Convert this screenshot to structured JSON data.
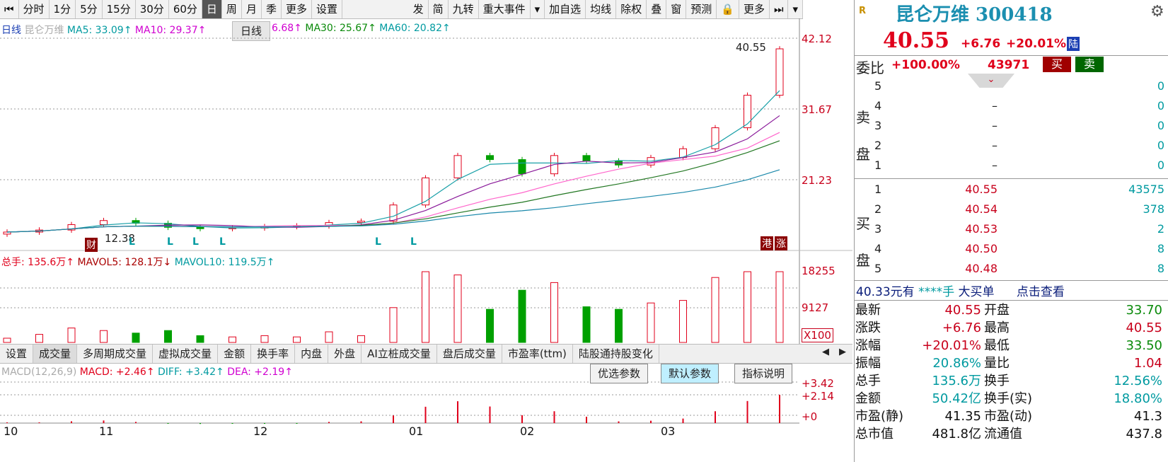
{
  "toolbar": {
    "left": [
      "分时",
      "1分",
      "5分",
      "15分",
      "30分",
      "60分",
      "日",
      "周",
      "月",
      "季",
      "更多",
      "设置"
    ],
    "right": [
      "发",
      "简",
      "九转",
      "重大事件",
      "▾",
      "加自选",
      "均线",
      "除权",
      "叠",
      "窗",
      "预测",
      "🔒",
      "更多",
      "⏭",
      "▾"
    ],
    "active": "日"
  },
  "tooltip": "日线",
  "ma_legend": {
    "label": "日线",
    "name": "昆仑万维",
    "ma5": "MA5: 33.09↑",
    "ma10": "MA10: 29.37↑",
    "ma20": "6.68↑",
    "ma30": "MA30: 25.67↑",
    "ma60": "MA60: 20.82↑"
  },
  "price_axis": [
    "42.12",
    "31.67",
    "21.23"
  ],
  "price_annotations": {
    "high": "40.55",
    "low": "12.38",
    "cai": "财",
    "gang": "港",
    "zhang": "涨",
    "l_marks": [
      "L",
      "L",
      "L",
      "L",
      "L",
      "L"
    ]
  },
  "volume_legend": {
    "total": "总手: 135.6万↑",
    "mavol5": "MAVOL5: 128.1万↓",
    "mavol10": "MAVOL10: 119.5万↑"
  },
  "volume_axis": [
    "18255",
    "9127",
    "X100"
  ],
  "tabs": [
    "设置",
    "成交量",
    "多周期成交量",
    "虚拟成交量",
    "金额",
    "换手率",
    "内盘",
    "外盘",
    "AI立桩成交量",
    "盘后成交量",
    "市盈率(ttm)",
    "陆股通持股变化"
  ],
  "tabs_active": "成交量",
  "macd_legend": {
    "name": "MACD(12,26,9)",
    "macd": "MACD: +2.46↑",
    "diff": "DIFF: +3.42↑",
    "dea": "DEA: +2.19↑"
  },
  "macd_buttons": [
    "优选参数",
    "默认参数",
    "指标说明"
  ],
  "macd_axis": [
    "+3.42",
    "+2.14",
    "+0"
  ],
  "x_axis": [
    "10",
    "11",
    "12",
    "01",
    "02",
    "03"
  ],
  "colors": {
    "up": "#e0001b",
    "down": "#00a000",
    "ma5": "#1aa0a8",
    "ma10": "#8a1a9a",
    "ma20": "#ff66cc",
    "ma30": "#227722",
    "ma60": "#1a88aa"
  },
  "chart_data": {
    "type": "candlestick",
    "title": "",
    "x": [
      "10",
      "11",
      "12",
      "01",
      "02",
      "03"
    ],
    "close_approx": [
      13.5,
      13.8,
      14.6,
      15.2,
      14.8,
      14.2,
      14.0,
      14.1,
      14.3,
      14.4,
      14.9,
      15.1,
      17.5,
      21.5,
      24.8,
      24.2,
      22.1,
      24.8,
      24.0,
      23.4,
      24.5,
      25.8,
      28.9,
      33.7,
      40.55
    ],
    "ylim": [
      12.0,
      43.0
    ]
  },
  "quote": {
    "r": "R",
    "name": "昆仑万维 300418",
    "price": "40.55",
    "change": "+6.76",
    "pct": "+20.01%",
    "lu": "陆",
    "wb_label": "委比",
    "wb_value": "+100.00%",
    "wb_diff": "43971",
    "buy_btn": "买",
    "sell_btn": "卖",
    "sell_label": [
      "卖",
      "盘"
    ],
    "buy_label": [
      "买",
      "盘"
    ],
    "sells": [
      {
        "lv": "5",
        "price": "",
        "vol": "0"
      },
      {
        "lv": "4",
        "price": "–",
        "vol": "0"
      },
      {
        "lv": "3",
        "price": "–",
        "vol": "0"
      },
      {
        "lv": "2",
        "price": "–",
        "vol": "0"
      },
      {
        "lv": "1",
        "price": "–",
        "vol": "0"
      }
    ],
    "buys": [
      {
        "lv": "1",
        "price": "40.55",
        "vol": "43575"
      },
      {
        "lv": "2",
        "price": "40.54",
        "vol": "378"
      },
      {
        "lv": "3",
        "price": "40.53",
        "vol": "2"
      },
      {
        "lv": "4",
        "price": "40.50",
        "vol": "8"
      },
      {
        "lv": "5",
        "price": "40.48",
        "vol": "8"
      }
    ],
    "bigbuy": {
      "amount": "40.33元有",
      "hands": "****手",
      "title": "大买单",
      "link": "点击查看"
    },
    "stats": [
      {
        "k1": "最新",
        "v1": "40.55",
        "k2": "开盘",
        "v2": "33.70"
      },
      {
        "k1": "涨跌",
        "v1": "+6.76",
        "k2": "最高",
        "v2": "40.55"
      },
      {
        "k1": "涨幅",
        "v1": "+20.01%",
        "k2": "最低",
        "v2": "33.50"
      },
      {
        "k1": "振幅",
        "v1": "20.86%",
        "k2": "量比",
        "v2": "1.04"
      },
      {
        "k1": "总手",
        "v1": "135.6万",
        "k2": "换手",
        "v2": "12.56%"
      },
      {
        "k1": "金额",
        "v1": "50.42亿",
        "k2": "换手(实)",
        "v2": "18.80%"
      },
      {
        "k1": "市盈(静)",
        "v1": "41.35",
        "k2": "市盈(动)",
        "v2": "41.3"
      },
      {
        "k1": "总市值",
        "v1": "481.8亿",
        "k2": "流通值",
        "v2": "437.8"
      }
    ]
  }
}
